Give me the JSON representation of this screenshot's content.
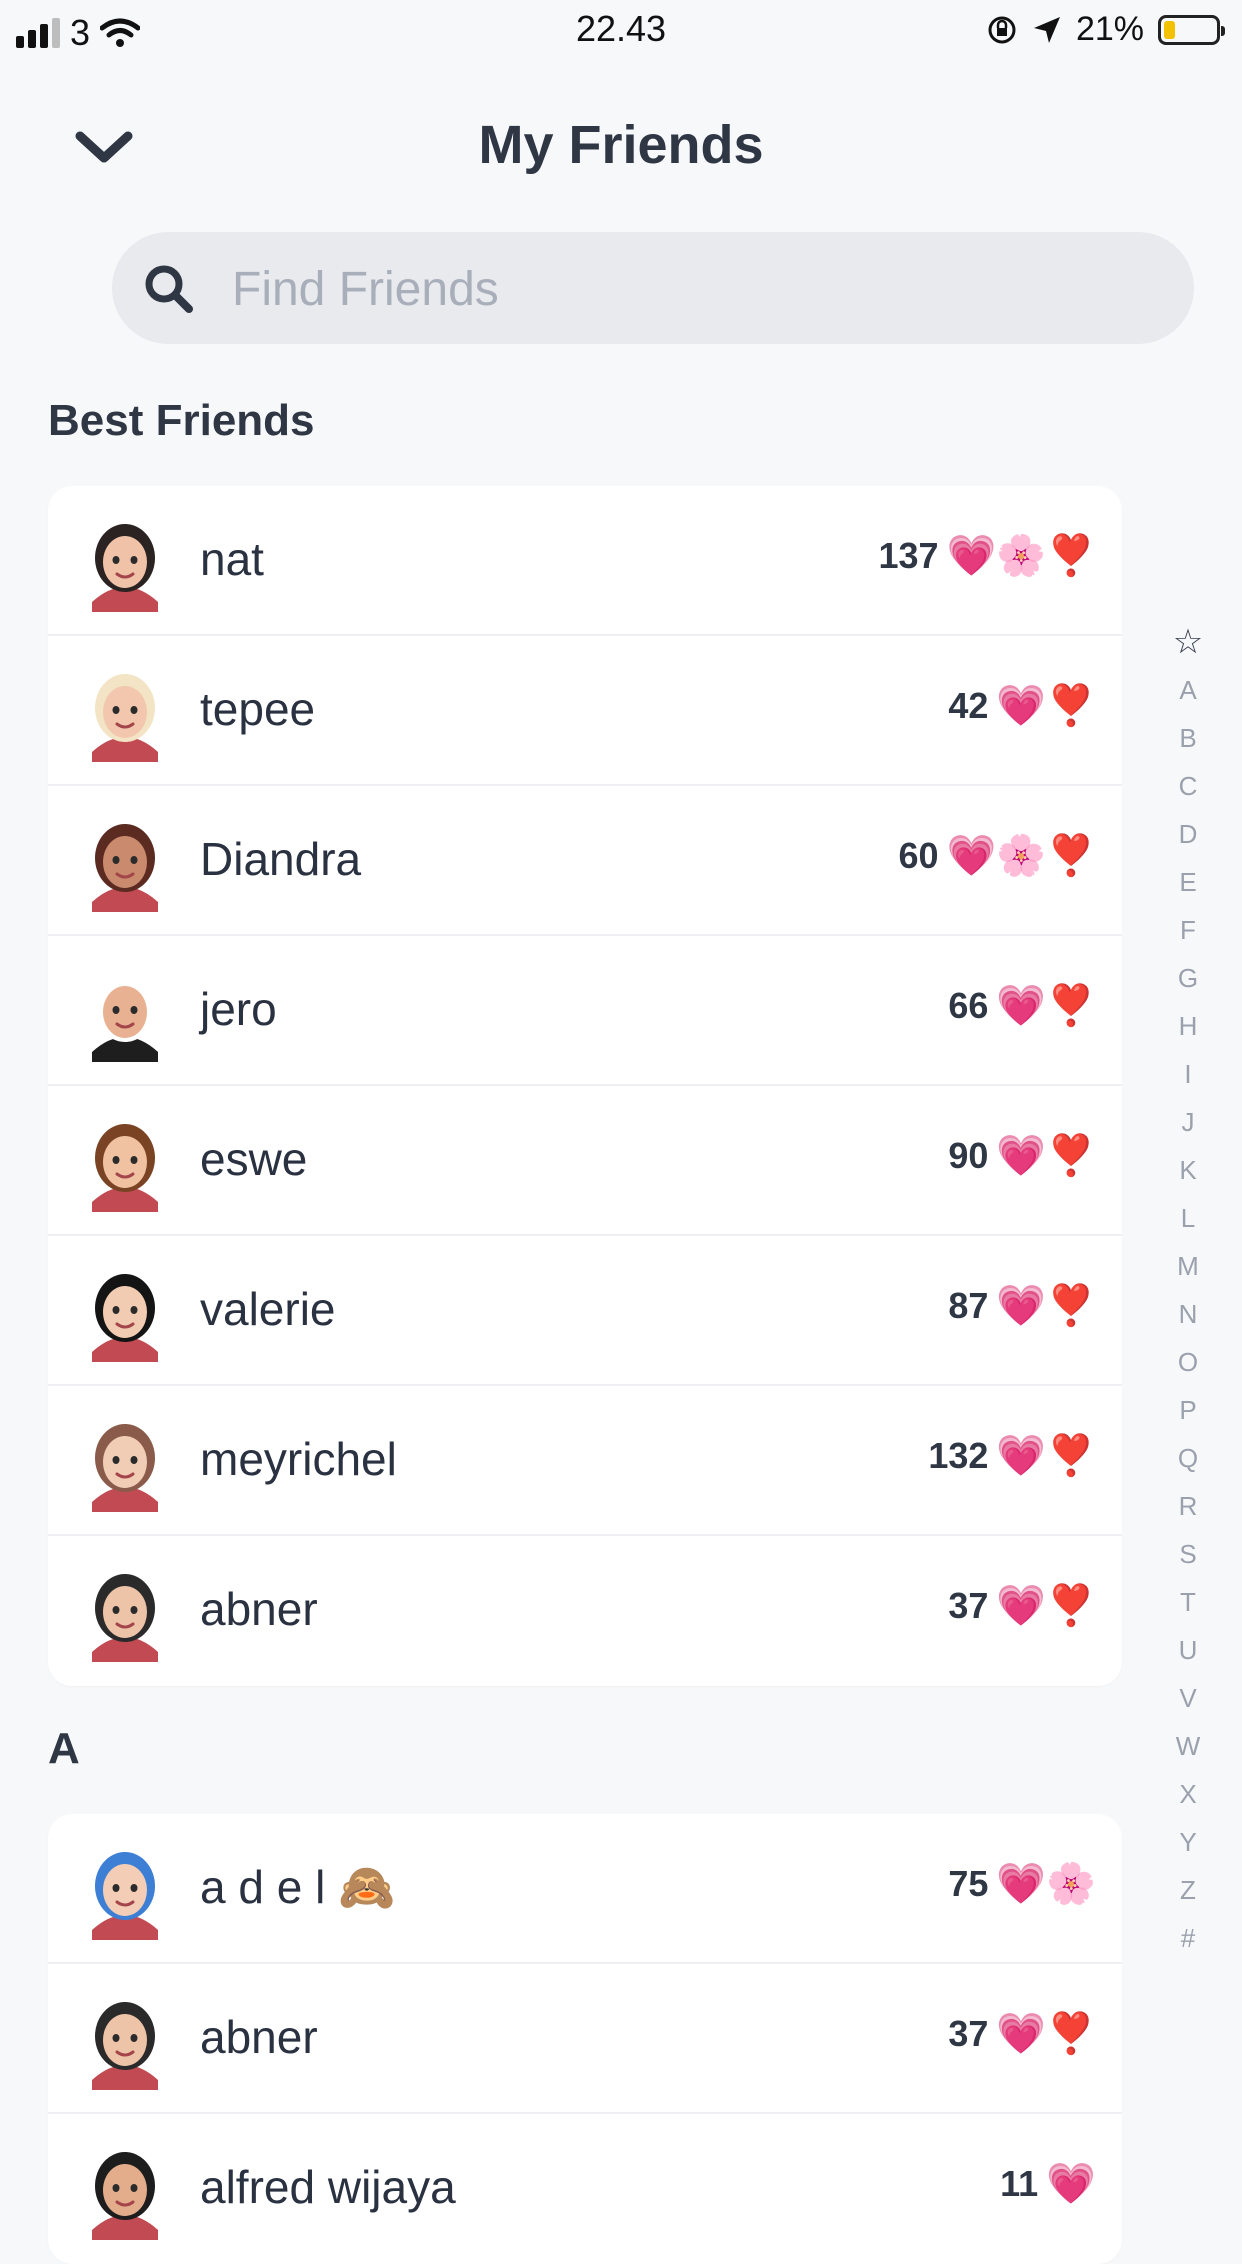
{
  "status_bar": {
    "carrier": "3",
    "time": "22.43",
    "battery": "21%",
    "battery_level": 0.21
  },
  "header": {
    "title": "My Friends",
    "back_icon": "chevron-down-icon"
  },
  "search": {
    "placeholder": "Find Friends",
    "icon": "search-icon"
  },
  "best_friends": {
    "title": "Best Friends",
    "items": [
      {
        "name": "nat",
        "score": "137",
        "emojis": "💗🌸❣️",
        "avatar_color": "#f0c3a8",
        "hair": "#2b2222"
      },
      {
        "name": "tepee",
        "score": "42",
        "emojis": "💗❣️",
        "avatar_color": "#f2c7ae",
        "hair": "#f3e4c6"
      },
      {
        "name": "Diandra",
        "score": "60",
        "emojis": "💗🌸❣️",
        "avatar_color": "#c98a6d",
        "hair": "#5b2b22"
      },
      {
        "name": "jero",
        "score": "66",
        "emojis": "💗❣️",
        "avatar_color": "#e8b191",
        "hair": "#ffffff"
      },
      {
        "name": "eswe",
        "score": "90",
        "emojis": "💗❣️",
        "avatar_color": "#f0c2a2",
        "hair": "#7a4424"
      },
      {
        "name": "valerie",
        "score": "87",
        "emojis": "💗❣️",
        "avatar_color": "#f1ccb2",
        "hair": "#141414"
      },
      {
        "name": "meyrichel",
        "score": "132",
        "emojis": "💗❣️",
        "avatar_color": "#f1cdb6",
        "hair": "#8a5a4a"
      },
      {
        "name": "abner",
        "score": "37",
        "emojis": "💗❣️",
        "avatar_color": "#eec4a8",
        "hair": "#2a2a2a"
      }
    ]
  },
  "section_a": {
    "title": "A",
    "items": [
      {
        "name": "a d e l 🙈",
        "score": "75",
        "emojis": "💗🌸",
        "avatar_color": "#f3cdb6",
        "hair": "#3c7fd4"
      },
      {
        "name": "abner",
        "score": "37",
        "emojis": "💗❣️",
        "avatar_color": "#eec4a8",
        "hair": "#2a2a2a"
      },
      {
        "name": "alfred wijaya",
        "score": "11",
        "emojis": "💗",
        "avatar_color": "#e3ad8c",
        "hair": "#1d1d1d"
      }
    ]
  },
  "alpha_index": [
    "☆",
    "A",
    "B",
    "C",
    "D",
    "E",
    "F",
    "G",
    "H",
    "I",
    "J",
    "K",
    "L",
    "M",
    "N",
    "O",
    "P",
    "Q",
    "R",
    "S",
    "T",
    "U",
    "V",
    "W",
    "X",
    "Y",
    "Z",
    "#"
  ]
}
